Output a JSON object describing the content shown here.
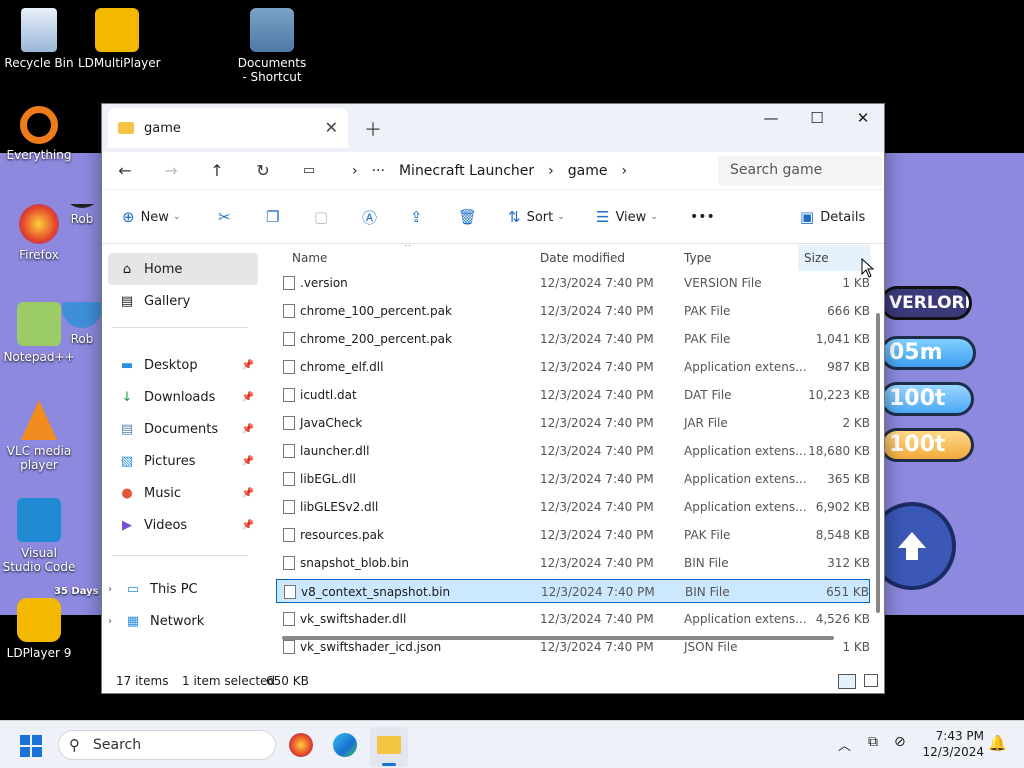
{
  "desktop": {
    "icons": [
      {
        "label": "Recycle Bin"
      },
      {
        "label": "LDMultiPlayer"
      },
      {
        "label": "Documents - Shortcut"
      },
      {
        "label": "Everything"
      },
      {
        "label": "Firefox"
      },
      {
        "label": "Rob"
      },
      {
        "label": "Notepad++"
      },
      {
        "label": "Rob"
      },
      {
        "label": "VLC media player"
      },
      {
        "label": "Visual Studio Code"
      },
      {
        "label": "LDPlayer 9"
      }
    ],
    "days_badge": "35 Days",
    "game_overlay": {
      "banner": "VERLORD",
      "stat1": "05m",
      "stat2": "100t",
      "stat3": "100t"
    }
  },
  "window": {
    "tab_title": "game",
    "breadcrumbs": [
      "Minecraft Launcher",
      "game"
    ],
    "search_placeholder": "Search game",
    "toolbar": {
      "new": "New",
      "sort": "Sort",
      "view": "View",
      "more": "•••",
      "details": "Details"
    },
    "sidebar": {
      "home": "Home",
      "gallery": "Gallery",
      "quick": [
        "Desktop",
        "Downloads",
        "Documents",
        "Pictures",
        "Music",
        "Videos"
      ],
      "this_pc": "This PC",
      "network": "Network"
    },
    "columns": {
      "name": "Name",
      "date": "Date modified",
      "type": "Type",
      "size": "Size"
    },
    "files": [
      {
        "name": ".version",
        "date": "12/3/2024 7:40 PM",
        "type": "VERSION File",
        "size": "1 KB"
      },
      {
        "name": "chrome_100_percent.pak",
        "date": "12/3/2024 7:40 PM",
        "type": "PAK File",
        "size": "666 KB"
      },
      {
        "name": "chrome_200_percent.pak",
        "date": "12/3/2024 7:40 PM",
        "type": "PAK File",
        "size": "1,041 KB"
      },
      {
        "name": "chrome_elf.dll",
        "date": "12/3/2024 7:40 PM",
        "type": "Application extens...",
        "size": "987 KB"
      },
      {
        "name": "icudtl.dat",
        "date": "12/3/2024 7:40 PM",
        "type": "DAT File",
        "size": "10,223 KB"
      },
      {
        "name": "JavaCheck",
        "date": "12/3/2024 7:40 PM",
        "type": "JAR File",
        "size": "2 KB"
      },
      {
        "name": "launcher.dll",
        "date": "12/3/2024 7:40 PM",
        "type": "Application extens...",
        "size": "18,680 KB"
      },
      {
        "name": "libEGL.dll",
        "date": "12/3/2024 7:40 PM",
        "type": "Application extens...",
        "size": "365 KB"
      },
      {
        "name": "libGLESv2.dll",
        "date": "12/3/2024 7:40 PM",
        "type": "Application extens...",
        "size": "6,902 KB"
      },
      {
        "name": "resources.pak",
        "date": "12/3/2024 7:40 PM",
        "type": "PAK File",
        "size": "8,548 KB"
      },
      {
        "name": "snapshot_blob.bin",
        "date": "12/3/2024 7:40 PM",
        "type": "BIN File",
        "size": "312 KB"
      },
      {
        "name": "v8_context_snapshot.bin",
        "date": "12/3/2024 7:40 PM",
        "type": "BIN File",
        "size": "651 KB"
      },
      {
        "name": "vk_swiftshader.dll",
        "date": "12/3/2024 7:40 PM",
        "type": "Application extens...",
        "size": "4,526 KB"
      },
      {
        "name": "vk_swiftshader_icd.json",
        "date": "12/3/2024 7:40 PM",
        "type": "JSON File",
        "size": "1 KB"
      }
    ],
    "selected_file": "v8_context_snapshot.bin",
    "status": {
      "items": "17 items",
      "selected": "1 item selected",
      "size": "650 KB"
    }
  },
  "taskbar": {
    "search": "Search",
    "time": "7:43 PM",
    "date": "12/3/2024"
  },
  "colors": {
    "accent": "#0067c0",
    "selection": "#cce8ff",
    "desktop_purple": "#8c89de"
  }
}
